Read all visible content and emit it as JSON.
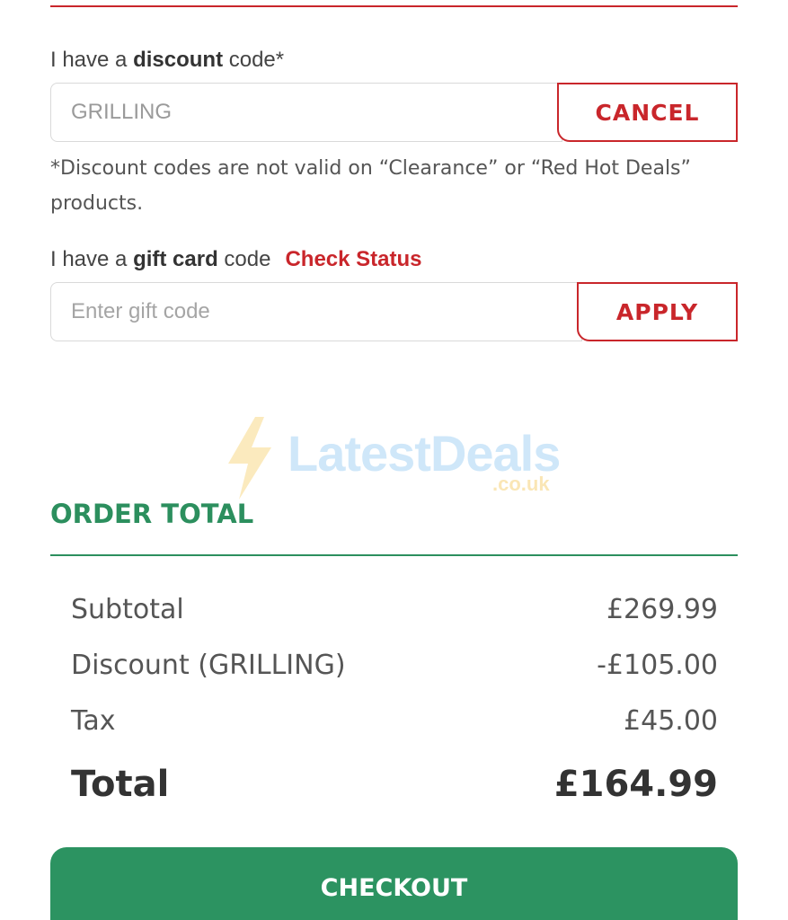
{
  "discount": {
    "label_prefix": "I have a ",
    "label_bold": "discount",
    "label_suffix": " code*",
    "input_value": "GRILLING",
    "button_label": "CANCEL",
    "disclaimer": "*Discount codes are not valid on “Clearance” or “Red Hot Deals” products."
  },
  "gift_card": {
    "label_prefix": "I have a ",
    "label_bold": "gift card",
    "label_suffix": " code",
    "check_status_link": "Check Status",
    "input_placeholder": "Enter gift code",
    "button_label": "APPLY"
  },
  "watermark": {
    "brand": "LatestDeals",
    "domain_suffix": ".co.uk"
  },
  "order_total": {
    "heading": "ORDER TOTAL",
    "rows": [
      {
        "label": "Subtotal",
        "value": "£269.99"
      },
      {
        "label": "Discount (GRILLING)",
        "value": "-£105.00"
      },
      {
        "label": "Tax",
        "value": "£45.00"
      }
    ],
    "total_label": "Total",
    "total_value": "£164.99"
  },
  "checkout": {
    "button_label": "CHECKOUT"
  },
  "colors": {
    "brand_red": "#c9262b",
    "brand_green": "#2c9361"
  }
}
